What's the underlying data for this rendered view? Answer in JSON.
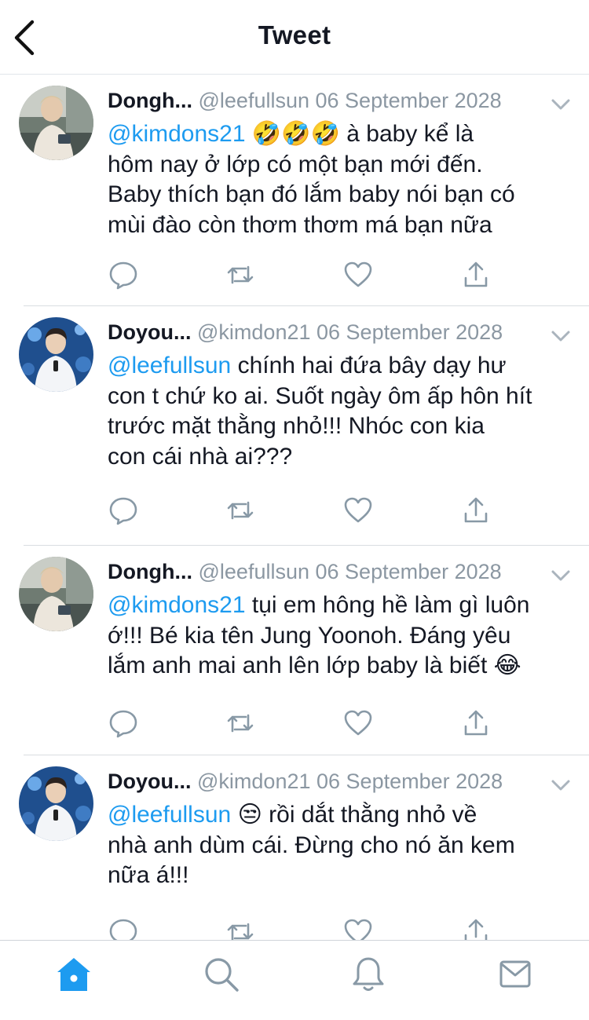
{
  "header": {
    "title": "Tweet"
  },
  "tweets": [
    {
      "name": "Dongh...",
      "handle": "@leefullsun",
      "date": "06 September 2028",
      "mention": "@kimdons21",
      "lines": [
        "🤣🤣🤣 à baby kể là",
        "hôm nay ở lớp có một bạn mới đến.",
        "Baby thích bạn đó lắm baby nói bạn có",
        "mùi đào còn thơm thơm má bạn nữa"
      ]
    },
    {
      "name": "Doyou...",
      "handle": "@kimdon21",
      "date": "06 September 2028",
      "mention": "@leefullsun",
      "lines": [
        "chính hai đứa bây dạy hư",
        "con t chứ ko ai. Suốt ngày ôm ấp hôn hít",
        "trước mặt thằng nhỏ!!! Nhóc con kia",
        "con cái nhà ai???"
      ]
    },
    {
      "name": "Dongh...",
      "handle": "@leefullsun",
      "date": "06 September 2028",
      "mention": "@kimdons21",
      "lines": [
        "tụi em hông hề làm gì luôn",
        "ớ!!! Bé kia tên Jung Yoonoh. Đáng yêu",
        "lắm anh mai anh lên lớp baby là biết 😂"
      ]
    },
    {
      "name": "Doyou...",
      "handle": "@kimdon21",
      "date": "06 September 2028",
      "mention": "@leefullsun",
      "lines": [
        "😒 rồi dắt thằng nhỏ về",
        "nhà anh dùm cái. Đừng cho nó ăn kem",
        "nữa á!!!"
      ]
    }
  ],
  "action_icons": [
    "reply-icon",
    "retweet-icon",
    "like-icon",
    "share-icon"
  ],
  "tabbar": [
    "home-icon",
    "search-icon",
    "notifications-icon",
    "messages-icon"
  ],
  "colors": {
    "accent": "#1d9bf0",
    "text": "#141823",
    "muted": "#8b97a2",
    "icon": "#8899a6"
  }
}
